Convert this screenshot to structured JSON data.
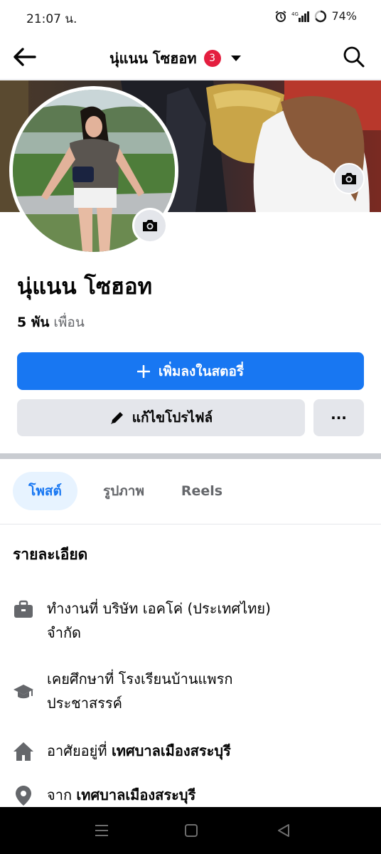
{
  "status_bar": {
    "time": "21:07 น.",
    "network": "4G",
    "battery": "74%"
  },
  "header": {
    "title": "นุ่แนน โซฮอท",
    "notification_count": "3"
  },
  "profile": {
    "name": "นุ่แนน โซฮอท",
    "friends_count": "5 พัน",
    "friends_label": "เพื่อน"
  },
  "actions": {
    "add_story_label": "เพิ่มลงในสตอรี่",
    "edit_profile_label": "แก้ไขโปรไฟล์",
    "more_label": "···"
  },
  "tabs": [
    {
      "label": "โพสต์",
      "active": true
    },
    {
      "label": "รูปภาพ",
      "active": false
    },
    {
      "label": "Reels",
      "active": false
    }
  ],
  "details": {
    "title": "รายละเอียด",
    "work_prefix": "ทำงานที่ บริษัท เอคโค่ (ประเทศไทย)",
    "work_suffix": "จำกัด",
    "education_line1": "เคยศึกษาที่ โรงเรียนบ้านแพรก",
    "education_line2": "ประชาสรรค์",
    "lives_prefix": "อาศัยอยู่ที่",
    "lives_place": "เทศบาลเมืองสระบุรี",
    "from_prefix": "จาก",
    "from_place": "เทศบาลเมืองสระบุรี"
  },
  "colors": {
    "accent": "#1877f2",
    "badge": "#e41e3f",
    "secondary_text": "#65676b",
    "button_gray": "#e4e6eb"
  },
  "icons": [
    "back-arrow-icon",
    "search-icon",
    "camera-icon",
    "plus-icon",
    "pencil-icon",
    "briefcase-icon",
    "graduation-cap-icon",
    "home-icon",
    "location-pin-icon"
  ]
}
